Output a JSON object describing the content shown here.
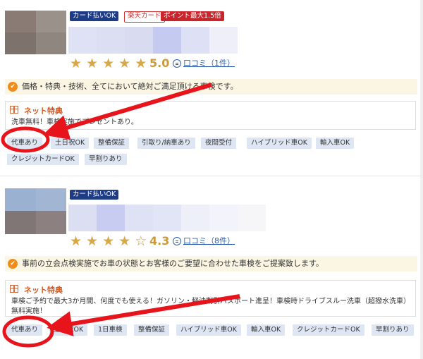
{
  "listings": [
    {
      "badges": {
        "card": "カード払いOK",
        "rakuten": "楽天カード",
        "points": "ポイント最大1.5倍"
      },
      "rating": {
        "stars": "★★★★★",
        "value": 5.0,
        "score_text": "5.0",
        "review_link": "口コミ（1件）"
      },
      "catchphrase": "価格・特典・技術、全てにおいて絶対ご満足頂ける車検です。",
      "net_benefit": {
        "title": "ネット特典",
        "description": "洗車無料！車検実施でプレゼントあり。"
      },
      "tags": [
        "代車あり",
        "土日祝OK",
        "整備保証",
        "引取り/納車あり",
        "夜間受付",
        "ハイブリッド車OK",
        "輸入車OK",
        "クレジットカードOK",
        "早割りあり"
      ]
    },
    {
      "badges": {
        "card": "カード払いOK"
      },
      "rating": {
        "stars": "★★★★☆",
        "value": 4.3,
        "score_text": "4.3",
        "review_link": "口コミ（8件）"
      },
      "catchphrase": "事前の立会点検実施でお車の状態とお客様のご要望に合わせた車検をご提案致します。",
      "net_benefit": {
        "title": "ネット特典",
        "description": "車検ご予約で最大3か月間、何度でも使える！ガソリン・軽油割引パスポート進呈！車検時ドライブスルー洗車（超撥水洗車）無料実施！"
      },
      "tags": [
        "代車あり",
        "土日祝OK",
        "1日車検",
        "整備保証",
        "ハイブリッド車OK",
        "輸入車OK",
        "クレジットカードOK",
        "早割りあり"
      ]
    }
  ],
  "colors": {
    "accent_navy": "#1d3c85",
    "accent_red": "#c9252c",
    "annotation_red": "#e8141c",
    "tag_bg": "#dfe6f3",
    "star": "#d6a84a",
    "link": "#2a5db0"
  },
  "icons": {
    "catch": "check-badge-icon",
    "gift": "gift-icon",
    "review": "speech-bubble-icon"
  }
}
